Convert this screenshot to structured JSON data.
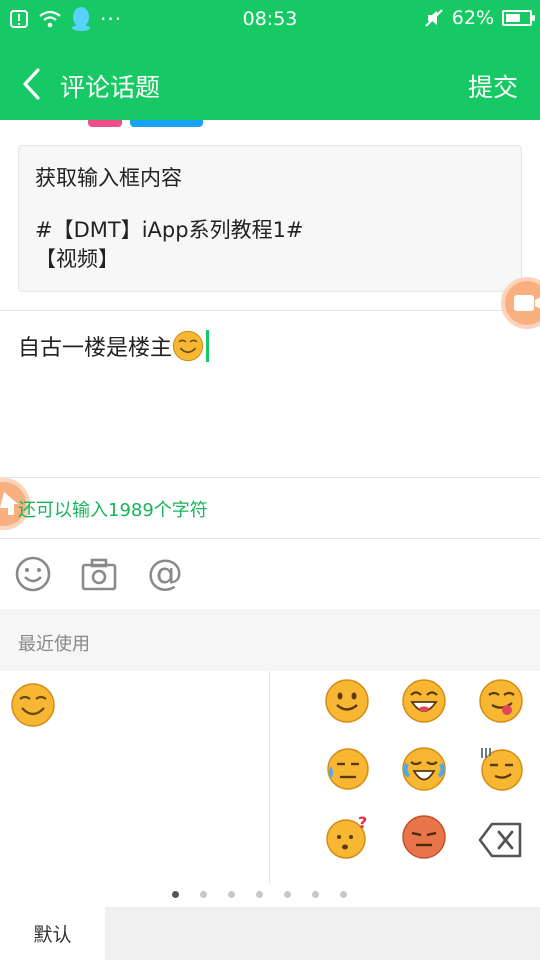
{
  "status_bar": {
    "time": "08:53",
    "battery_text": "62%",
    "battery_level": 0.62,
    "dots": "···"
  },
  "header": {
    "title": "评论话题",
    "submit_label": "提交"
  },
  "topic": {
    "line1": "获取输入框内容",
    "line2": "#【DMT】iApp系列教程1#",
    "line3": "【视频】"
  },
  "input": {
    "value": "自古一楼是楼主"
  },
  "counter_text": "还可以输入1989个字符",
  "toolbar": {
    "at_symbol": "@"
  },
  "emoji_panel": {
    "recent_title": "最近使用",
    "recent": [
      "grin-squint"
    ],
    "grid": [
      [
        "smile",
        "laugh",
        "tongue"
      ],
      [
        "sweat",
        "cry-laugh",
        "awkward"
      ],
      [
        "confused",
        "angry-red",
        "backspace"
      ]
    ],
    "pages": 7,
    "active_page": 1
  },
  "tabs": {
    "default_label": "默认"
  },
  "colors": {
    "brand_green": "#17c964",
    "counter_green": "#17b45a",
    "emoji_yellow": "#f7b733",
    "accent_orange": "#f8b080"
  }
}
